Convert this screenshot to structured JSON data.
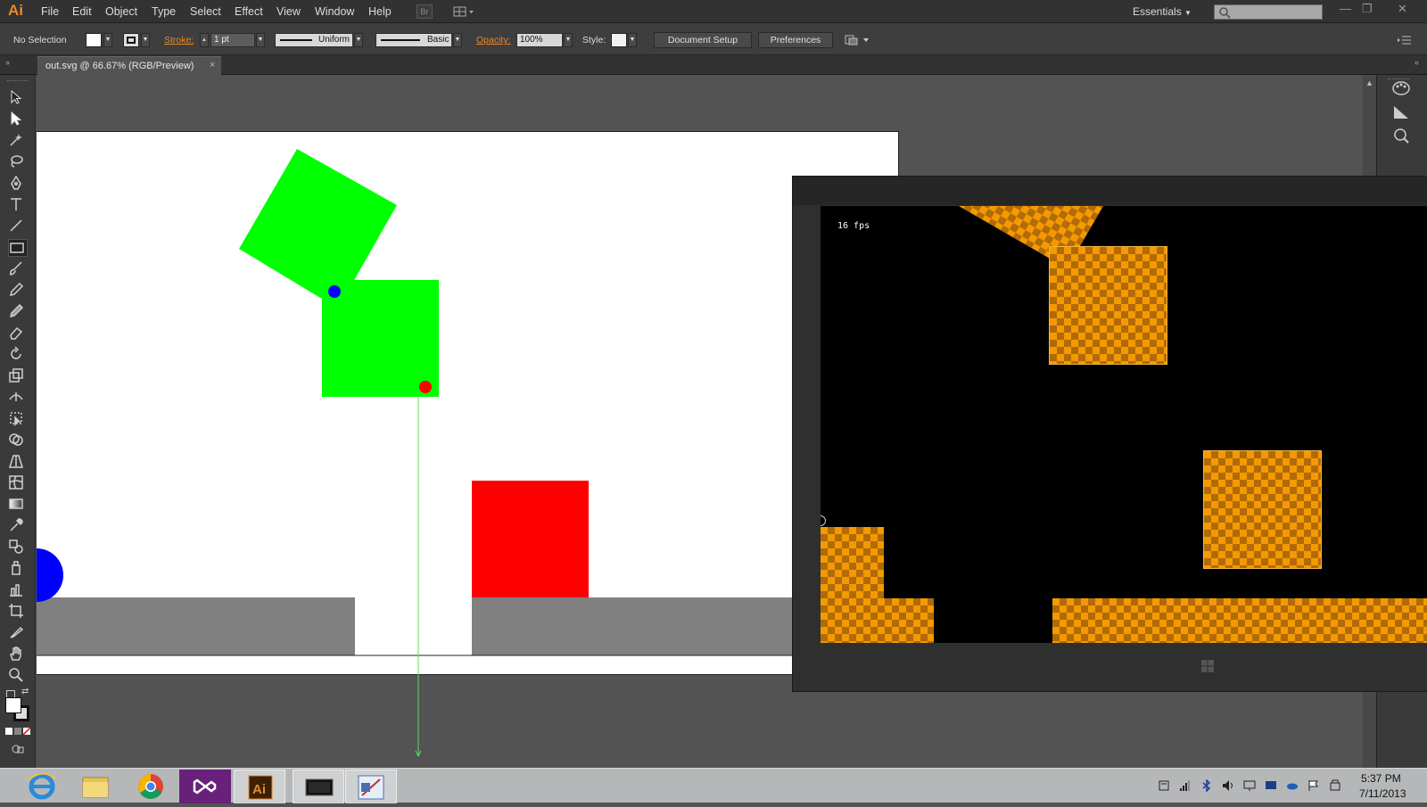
{
  "app": {
    "logo_text": "Ai"
  },
  "menu": [
    "File",
    "Edit",
    "Object",
    "Type",
    "Select",
    "Effect",
    "View",
    "Window",
    "Help"
  ],
  "menubar": {
    "bridge_label": "Br",
    "workspace": "Essentials"
  },
  "control_bar": {
    "selection": "No Selection",
    "stroke_label": "Stroke:",
    "stroke_weight": "1 pt",
    "profile": "Uniform",
    "brush": "Basic",
    "opacity_label": "Opacity:",
    "opacity_value": "100%",
    "style_label": "Style:",
    "document_setup": "Document Setup",
    "preferences": "Preferences"
  },
  "document_tab": {
    "title": "out.svg @ 66.67% (RGB/Preview)",
    "close": "×"
  },
  "tools": [
    "selection-tool",
    "direct-selection-tool",
    "magic-wand-tool",
    "lasso-tool",
    "pen-tool",
    "type-tool",
    "line-segment-tool",
    "rectangle-tool",
    "paintbrush-tool",
    "pencil-tool",
    "blob-brush-tool",
    "eraser-tool",
    "rotate-tool",
    "scale-tool",
    "width-tool",
    "free-transform-tool",
    "shape-builder-tool",
    "perspective-grid-tool",
    "mesh-tool",
    "gradient-tool",
    "eyedropper-tool",
    "blend-tool",
    "symbol-sprayer-tool",
    "column-graph-tool",
    "artboard-tool",
    "slice-tool",
    "hand-tool",
    "zoom-tool"
  ],
  "artwork_colors": {
    "green": "#00ff00",
    "red": "#ff0000",
    "blue": "#0000ff",
    "gray": "#808080",
    "guide": "#5ddc5d"
  },
  "game": {
    "fps_text": "16 fps",
    "background": "#000000",
    "checker_colors": [
      "#f49a00",
      "#b06a08"
    ]
  },
  "taskbar": {
    "apps": [
      "internet-explorer",
      "file-explorer",
      "chrome",
      "visual-studio",
      "illustrator",
      "game-window",
      "paint-tool"
    ],
    "time": "5:37 PM",
    "date": "7/11/2013"
  }
}
